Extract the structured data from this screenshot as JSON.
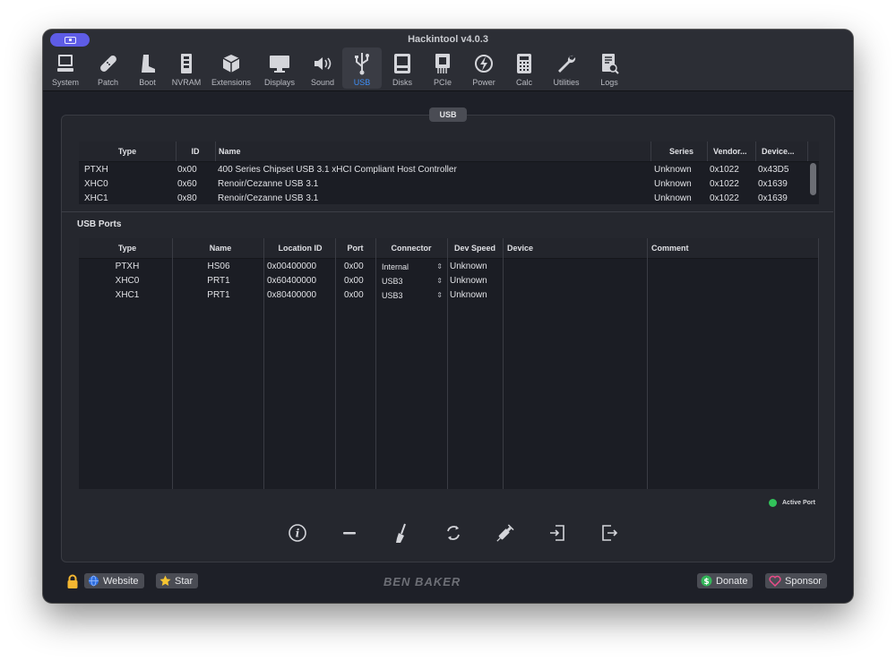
{
  "window": {
    "title": "Hackintool v4.0.3"
  },
  "toolbar": {
    "items": [
      {
        "label": "System",
        "icon": "computer-icon"
      },
      {
        "label": "Patch",
        "icon": "bandage-icon"
      },
      {
        "label": "Boot",
        "icon": "boot-icon"
      },
      {
        "label": "NVRAM",
        "icon": "memory-icon"
      },
      {
        "label": "Extensions",
        "icon": "box-icon"
      },
      {
        "label": "Displays",
        "icon": "display-icon"
      },
      {
        "label": "Sound",
        "icon": "speaker-icon"
      },
      {
        "label": "USB",
        "icon": "usb-icon",
        "active": true
      },
      {
        "label": "Disks",
        "icon": "disk-icon"
      },
      {
        "label": "PCIe",
        "icon": "pcie-icon"
      },
      {
        "label": "Power",
        "icon": "power-icon"
      },
      {
        "label": "Calc",
        "icon": "calculator-icon"
      },
      {
        "label": "Utilities",
        "icon": "wrench-icon"
      },
      {
        "label": "Logs",
        "icon": "log-icon"
      }
    ]
  },
  "usb_tab": {
    "label": "USB"
  },
  "controllers": {
    "headers": {
      "type": "Type",
      "id": "ID",
      "name": "Name",
      "series": "Series",
      "vendor": "Vendor...",
      "device": "Device..."
    },
    "rows": [
      {
        "type": "PTXH",
        "id": "0x00",
        "name": "400 Series Chipset USB 3.1 xHCI Compliant Host Controller",
        "series": "Unknown",
        "vendor": "0x1022",
        "device": "0x43D5"
      },
      {
        "type": "XHC0",
        "id": "0x60",
        "name": "Renoir/Cezanne USB 3.1",
        "series": "Unknown",
        "vendor": "0x1022",
        "device": "0x1639"
      },
      {
        "type": "XHC1",
        "id": "0x80",
        "name": "Renoir/Cezanne USB 3.1",
        "series": "Unknown",
        "vendor": "0x1022",
        "device": "0x1639"
      }
    ]
  },
  "ports_section": {
    "title": "USB Ports"
  },
  "ports": {
    "headers": {
      "type": "Type",
      "name": "Name",
      "location": "Location ID",
      "port": "Port",
      "connector": "Connector",
      "speed": "Dev Speed",
      "device": "Device",
      "comment": "Comment"
    },
    "rows": [
      {
        "type": "PTXH",
        "name": "HS06",
        "location": "0x00400000",
        "port": "0x00",
        "connector": "Internal",
        "speed": "Unknown",
        "device": "",
        "comment": ""
      },
      {
        "type": "XHC0",
        "name": "PRT1",
        "location": "0x60400000",
        "port": "0x00",
        "connector": "USB3",
        "speed": "Unknown",
        "device": "",
        "comment": ""
      },
      {
        "type": "XHC1",
        "name": "PRT1",
        "location": "0x80400000",
        "port": "0x00",
        "connector": "USB3",
        "speed": "Unknown",
        "device": "",
        "comment": ""
      }
    ]
  },
  "legend": {
    "active_port": "Active Port",
    "active_color": "#32c25a"
  },
  "actions": [
    {
      "name": "info-button",
      "icon": "info-icon"
    },
    {
      "name": "remove-button",
      "icon": "minus-icon"
    },
    {
      "name": "clear-button",
      "icon": "broom-icon"
    },
    {
      "name": "refresh-button",
      "icon": "refresh-icon"
    },
    {
      "name": "inject-button",
      "icon": "syringe-icon"
    },
    {
      "name": "import-button",
      "icon": "import-icon"
    },
    {
      "name": "export-button",
      "icon": "export-icon"
    }
  ],
  "footer": {
    "website": "Website",
    "star": "Star",
    "brand": "BEN BAKER",
    "donate": "Donate",
    "sponsor": "Sponsor"
  },
  "colors": {
    "accent": "#3e8df5",
    "toggle": "#5e5ce6",
    "lock": "#f5b731"
  }
}
